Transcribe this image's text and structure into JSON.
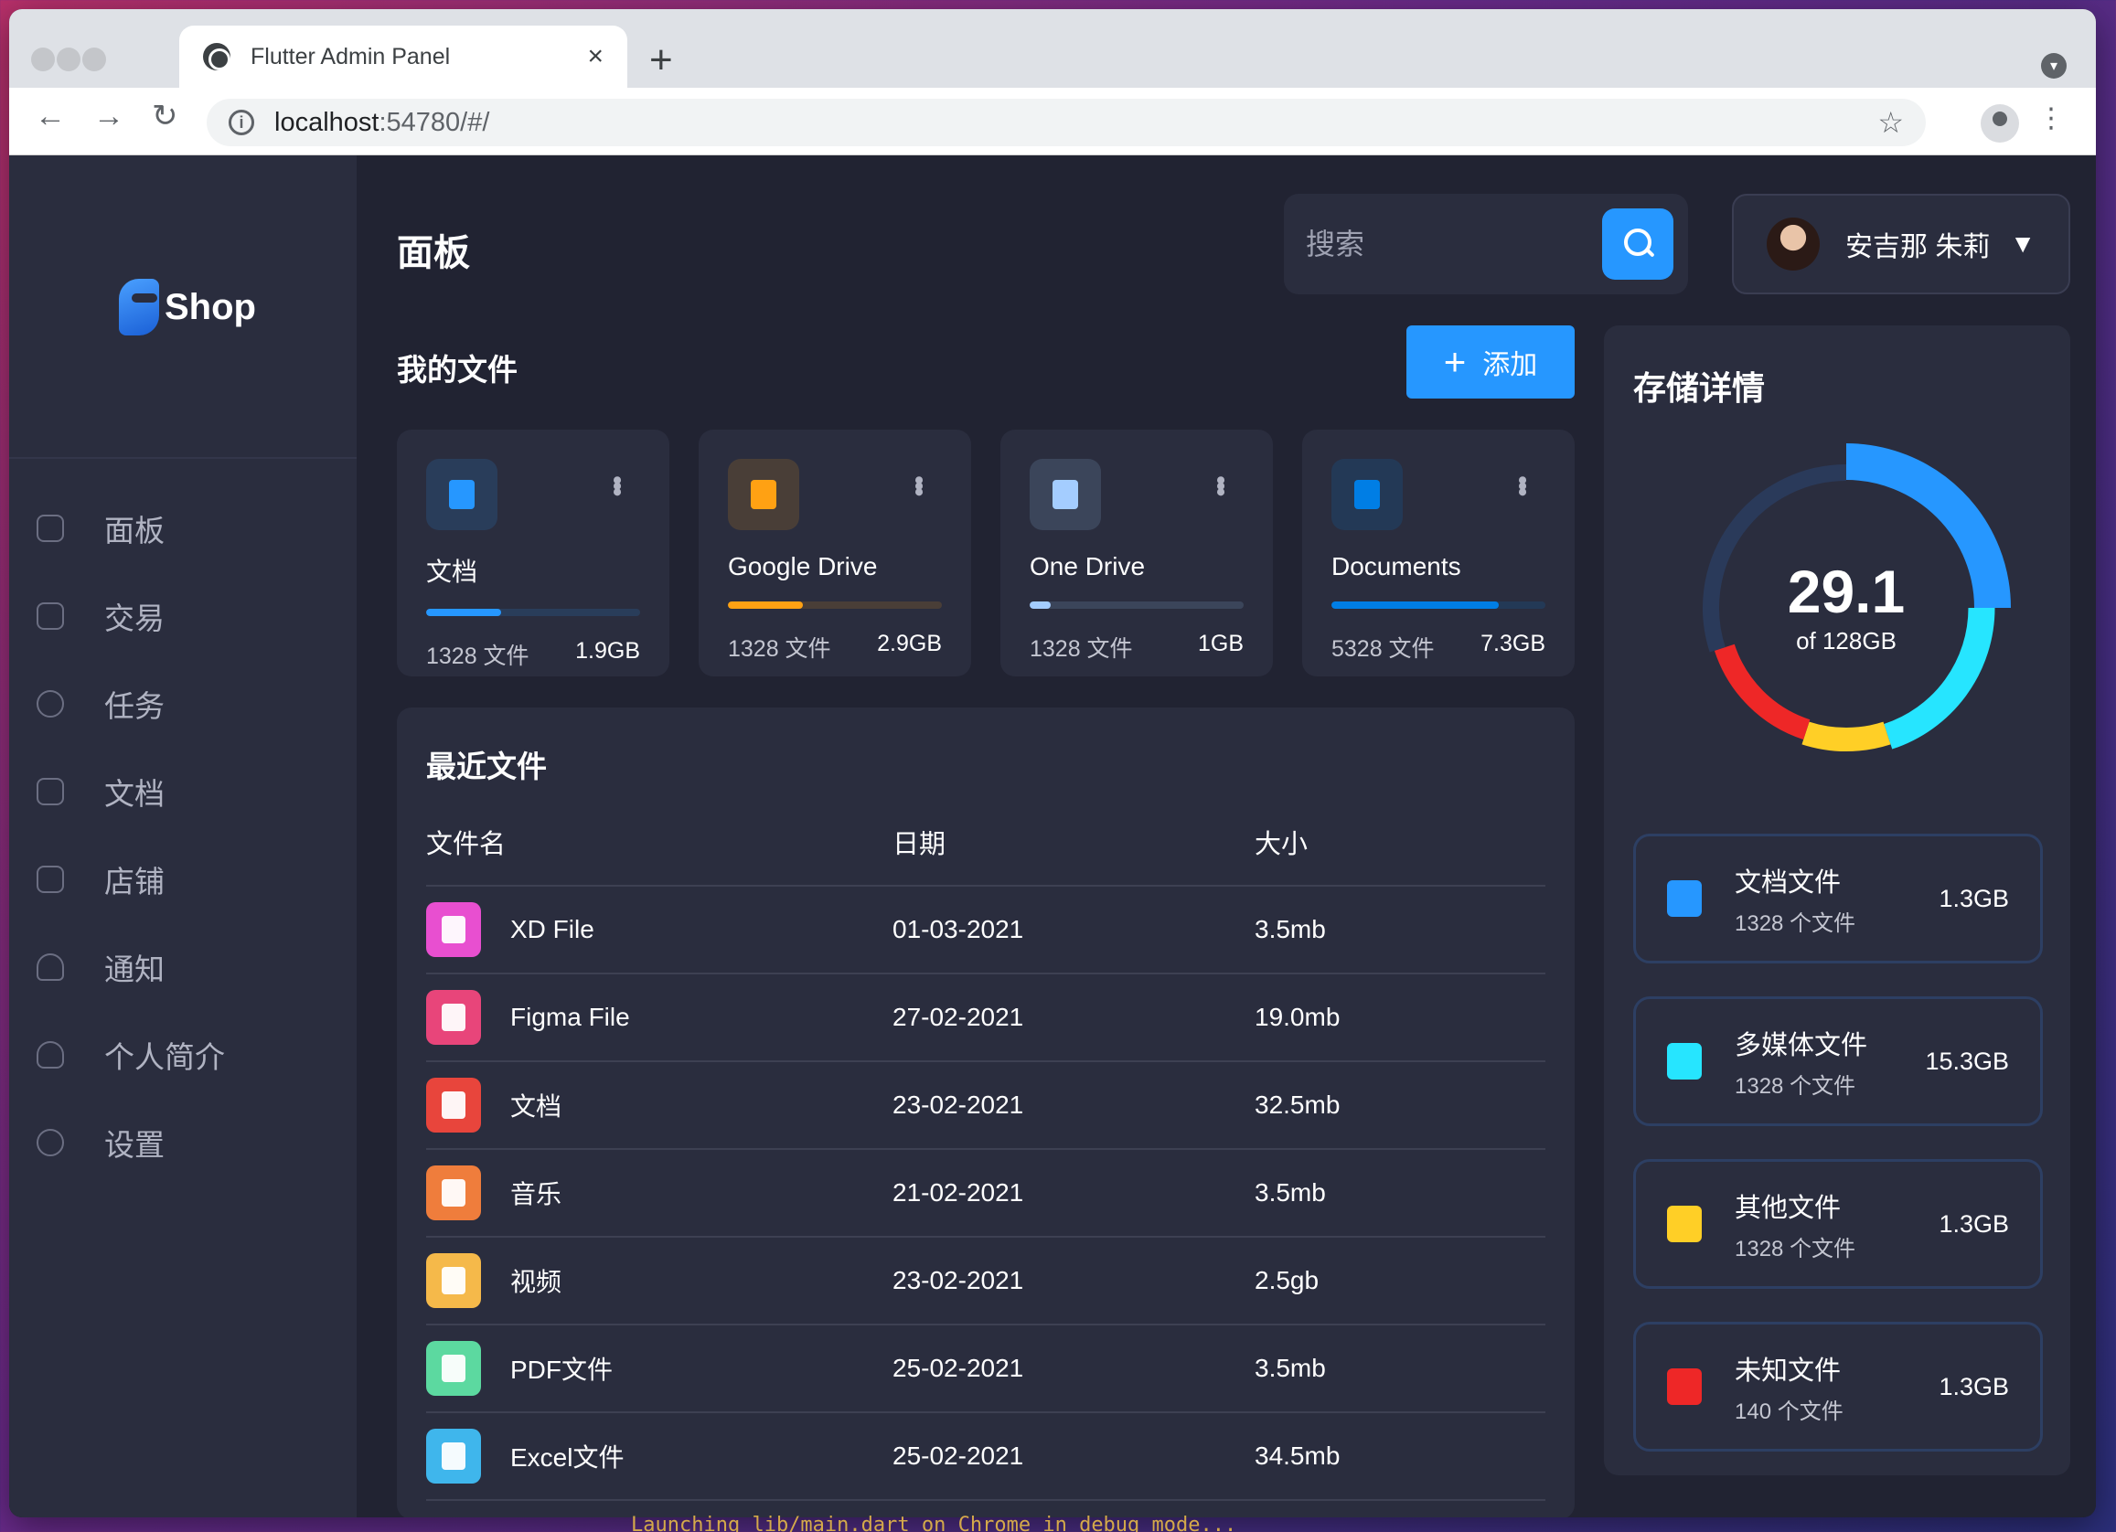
{
  "browser": {
    "tab_title": "Flutter Admin Panel",
    "tab_close": "×",
    "new_tab": "+",
    "url_host": "localhost",
    "url_rest": ":54780/#/",
    "back": "←",
    "forward": "→",
    "reload": "↻",
    "star": "☆",
    "menu": "⋮"
  },
  "sidebar": {
    "logo_text": "Shop",
    "items": [
      {
        "label": "面板",
        "icon": "dashboard-icon"
      },
      {
        "label": "交易",
        "icon": "transaction-icon"
      },
      {
        "label": "任务",
        "icon": "task-icon"
      },
      {
        "label": "文档",
        "icon": "document-icon"
      },
      {
        "label": "店铺",
        "icon": "store-icon"
      },
      {
        "label": "通知",
        "icon": "notification-icon"
      },
      {
        "label": "个人简介",
        "icon": "profile-icon"
      },
      {
        "label": "设置",
        "icon": "settings-icon"
      }
    ]
  },
  "header": {
    "title": "面板",
    "search_placeholder": "搜索",
    "user_name": "安吉那 朱莉",
    "chevron": "⌄"
  },
  "my_files": {
    "title": "我的文件",
    "add_label": "添加",
    "add_icon": "+",
    "cards": [
      {
        "title": "文档",
        "files": "1328 文件",
        "size": "1.9GB",
        "color": "#2697ff",
        "percent": 35,
        "icon": "document-icon"
      },
      {
        "title": "Google Drive",
        "files": "1328 文件",
        "size": "2.9GB",
        "color": "#ffa113",
        "percent": 35,
        "icon": "google-drive-icon"
      },
      {
        "title": "One Drive",
        "files": "1328 文件",
        "size": "1GB",
        "color": "#a4cdff",
        "percent": 10,
        "icon": "one-drive-icon"
      },
      {
        "title": "Documents",
        "files": "5328 文件",
        "size": "7.3GB",
        "color": "#007ee5",
        "percent": 78,
        "icon": "dropbox-icon"
      }
    ]
  },
  "recent": {
    "title": "最近文件",
    "headers": [
      "文件名",
      "日期",
      "大小"
    ],
    "rows": [
      {
        "name": "XD File",
        "date": "01-03-2021",
        "size": "3.5mb",
        "color": "#e84fd0",
        "icon": "xd-file-icon"
      },
      {
        "name": "Figma File",
        "date": "27-02-2021",
        "size": "19.0mb",
        "color": "#e8457a",
        "icon": "figma-file-icon"
      },
      {
        "name": "文档",
        "date": "23-02-2021",
        "size": "32.5mb",
        "color": "#e8453c",
        "icon": "doc-file-icon"
      },
      {
        "name": "音乐",
        "date": "21-02-2021",
        "size": "3.5mb",
        "color": "#ef7d3c",
        "icon": "music-file-icon"
      },
      {
        "name": "视频",
        "date": "23-02-2021",
        "size": "2.5gb",
        "color": "#f5b94a",
        "icon": "video-file-icon"
      },
      {
        "name": "PDF文件",
        "date": "25-02-2021",
        "size": "3.5mb",
        "color": "#5cd9a0",
        "icon": "pdf-file-icon"
      },
      {
        "name": "Excel文件",
        "date": "25-02-2021",
        "size": "34.5mb",
        "color": "#3fb6ec",
        "icon": "excel-file-icon"
      }
    ]
  },
  "storage": {
    "title": "存储详情",
    "used": "29.1",
    "total": "of 128GB",
    "segments": [
      {
        "name": "blue",
        "color": "#2697ff",
        "value": 25
      },
      {
        "name": "cyan",
        "color": "#26e5ff",
        "value": 20
      },
      {
        "name": "yellow",
        "color": "#ffcf26",
        "value": 10
      },
      {
        "name": "red",
        "color": "#ee2727",
        "value": 15
      },
      {
        "name": "rest",
        "color": "#2a3a5a",
        "value": 30
      }
    ],
    "items": [
      {
        "name": "文档文件",
        "count": "1328 个文件",
        "size": "1.3GB",
        "color": "#2697ff",
        "icon": "document-file-icon"
      },
      {
        "name": "多媒体文件",
        "count": "1328 个文件",
        "size": "15.3GB",
        "color": "#26e5ff",
        "icon": "media-file-icon"
      },
      {
        "name": "其他文件",
        "count": "1328 个文件",
        "size": "1.3GB",
        "color": "#ffcf26",
        "icon": "folder-icon"
      },
      {
        "name": "未知文件",
        "count": "140 个文件",
        "size": "1.3GB",
        "color": "#ee2727",
        "icon": "unknown-file-icon"
      }
    ]
  },
  "terminal_hint": "Launching lib/main.dart on Chrome in debug mode..."
}
